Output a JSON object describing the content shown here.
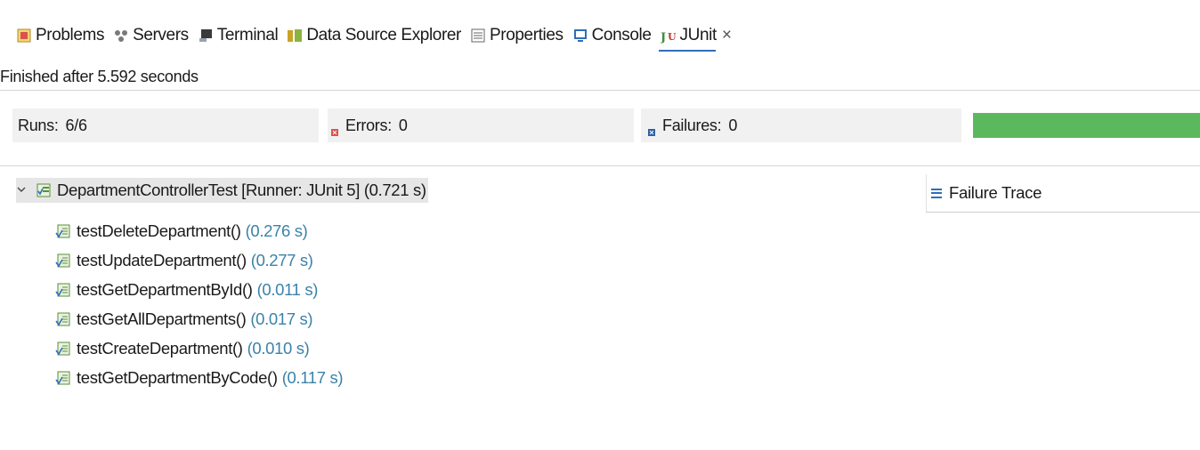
{
  "tabs": [
    {
      "label": "Problems",
      "icon": "problems-icon"
    },
    {
      "label": "Servers",
      "icon": "servers-icon"
    },
    {
      "label": "Terminal",
      "icon": "terminal-icon"
    },
    {
      "label": "Data Source Explorer",
      "icon": "data-source-icon"
    },
    {
      "label": "Properties",
      "icon": "properties-icon"
    },
    {
      "label": "Console",
      "icon": "console-icon"
    },
    {
      "label": "JUnit",
      "icon": "junit-icon",
      "active": true,
      "close": "×"
    }
  ],
  "status": "Finished after 5.592 seconds",
  "counters": {
    "runs_label": "Runs:",
    "runs_value": "6/6",
    "errors_label": "Errors:",
    "errors_value": "0",
    "failures_label": "Failures:",
    "failures_value": "0",
    "progress": 1.0,
    "progress_color": "#5cb85c"
  },
  "tree": {
    "root": {
      "label": "DepartmentControllerTest [Runner: JUnit 5] (0.721 s)",
      "icon": "test-suite-icon",
      "expanded": true
    },
    "tests": [
      {
        "name": "testDeleteDepartment()",
        "time": "(0.276 s)"
      },
      {
        "name": "testUpdateDepartment()",
        "time": "(0.277 s)"
      },
      {
        "name": "testGetDepartmentById()",
        "time": "(0.011 s)"
      },
      {
        "name": "testGetAllDepartments()",
        "time": "(0.017 s)"
      },
      {
        "name": "testCreateDepartment()",
        "time": "(0.010 s)"
      },
      {
        "name": "testGetDepartmentByCode()",
        "time": "(0.117 s)"
      }
    ]
  },
  "failure_trace": {
    "label": "Failure Trace",
    "icon": "failure-trace-icon"
  },
  "colors": {
    "time": "#3b82a8",
    "active_tab_underline": "#2f6fb7",
    "progress": "#5cb85c"
  }
}
